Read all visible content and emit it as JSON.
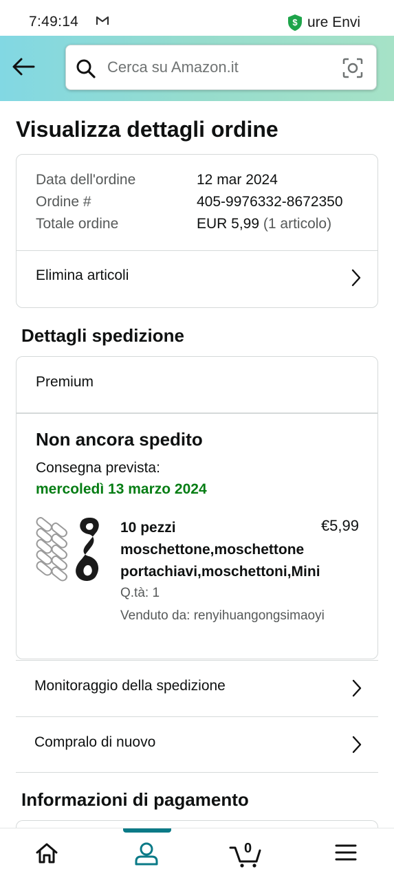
{
  "status_bar": {
    "time": "7:49:14",
    "secure_text": "ure Envi"
  },
  "header": {
    "back_icon": "arrow-left-icon",
    "search_placeholder": "Cerca su Amazon.it",
    "camera_icon": "camera-scan-icon"
  },
  "page_title": "Visualizza dettagli ordine",
  "order_summary": {
    "date_label": "Data dell'ordine",
    "date_value": "12 mar 2024",
    "number_label": "Ordine #",
    "number_value": "405-9976332-8672350",
    "total_label": "Totale ordine",
    "total_value": "EUR 5,99",
    "total_items": "(1 articolo)",
    "remove_items_label": "Elimina articoli"
  },
  "shipment": {
    "section_title": "Dettagli spedizione",
    "method": "Premium",
    "status": "Non ancora spedito",
    "delivery_label": "Consegna prevista:",
    "delivery_date": "mercoledì 13 marzo 2024",
    "delivery_color": "#067d14",
    "item": {
      "title": "10 pezzi moschettone,moschettone portachiavi,moschettoni,Mini",
      "price": "€5,99",
      "quantity": "Q.tà: 1",
      "seller": "Venduto da: renyihuangongsimaoyi"
    },
    "track_label": "Monitoraggio della spedizione",
    "buy_again_label": "Compralo di nuovo"
  },
  "payment": {
    "section_title": "Informazioni di pagamento"
  },
  "bottom_nav": {
    "items": [
      "home-icon",
      "account-icon",
      "cart-icon",
      "menu-icon"
    ],
    "active": "account-icon",
    "cart_count": "0",
    "accent_color": "#0a7a87"
  }
}
